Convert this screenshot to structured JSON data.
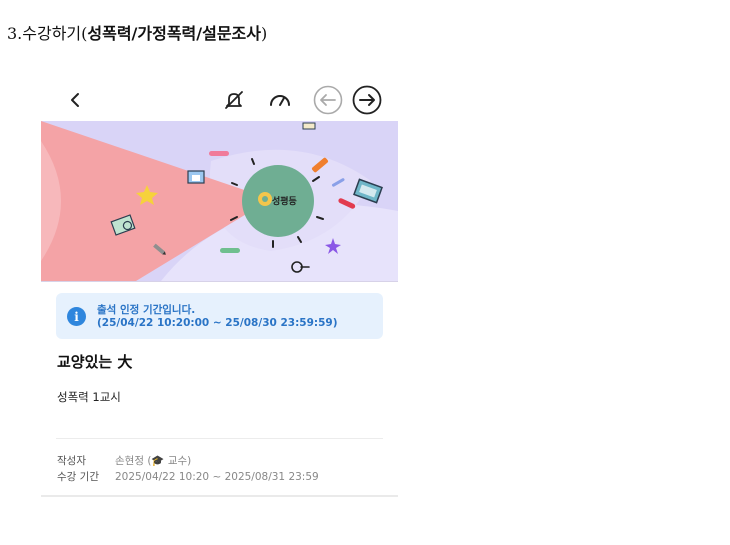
{
  "heading": {
    "prefix": "3.수강하기(",
    "bold_text": "성폭력/가정폭력/설문조사",
    "suffix": ")"
  },
  "toolbar": {
    "icons": [
      "back-icon",
      "mute-icon",
      "speedometer-icon",
      "previous-icon",
      "next-icon"
    ]
  },
  "banner": {
    "badge_text": "성평등",
    "colors": {
      "background": "#d9d4f7",
      "cone": "#f4a3a6",
      "circle": "#6fae93"
    }
  },
  "notice": {
    "icon": "info-icon",
    "line1": "출석 인정 기간입니다.",
    "line2": "(25/04/22 10:20:00 ~ 25/08/30 23:59:59)"
  },
  "course": {
    "title": "교양있는 大",
    "lesson": "성폭력 1교시"
  },
  "meta": {
    "author_label": "작성자",
    "author_value": "손현정 (🎓 교수)",
    "period_label": "수강 기간",
    "period_value": "2025/04/22 10:20 ~ 2025/08/31 23:59"
  }
}
